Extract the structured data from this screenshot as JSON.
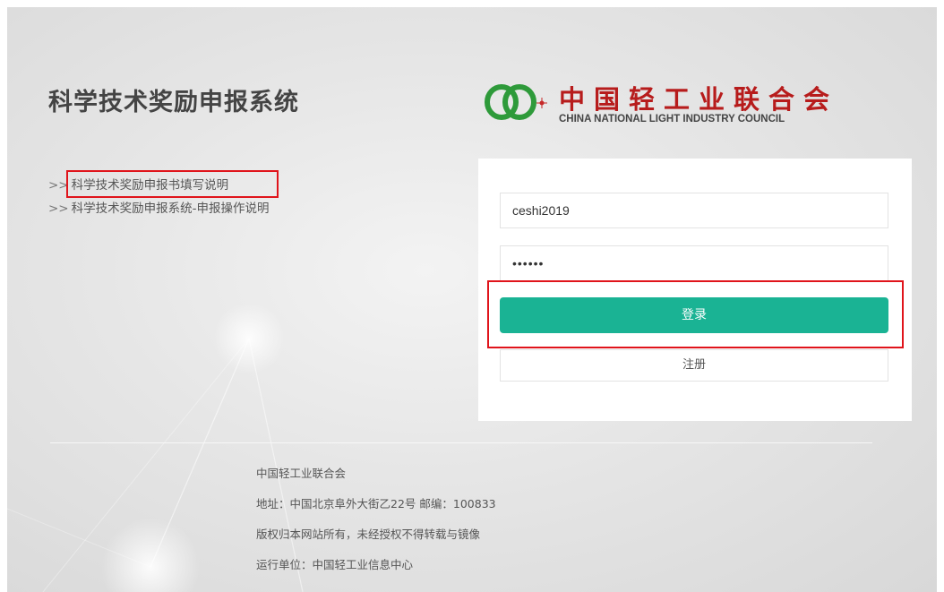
{
  "system_title": "科学技术奖励申报系统",
  "links": [
    {
      "prefix": ">>",
      "label": "科学技术奖励申报书填写说明"
    },
    {
      "prefix": ">>",
      "label": "科学技术奖励申报系统-申报操作说明"
    }
  ],
  "logo": {
    "name_cn": "中国轻工业联合会",
    "name_en": "CHINA NATIONAL LIGHT INDUSTRY COUNCIL",
    "icon": "cnlic-logo-icon"
  },
  "login": {
    "username_value": "ceshi2019",
    "password_value": "••••••",
    "login_label": "登录",
    "register_label": "注册"
  },
  "footer": {
    "org": "中国轻工业联合会",
    "address": "地址：中国北京阜外大街乙22号 邮编：100833",
    "copyright": "版权归本网站所有，未经授权不得转载与镜像",
    "operator": "运行单位：中国轻工业信息中心"
  },
  "colors": {
    "primary_button": "#1ab394",
    "annotation_box": "#e0141b",
    "logo_red": "#b71c1c",
    "logo_green": "#2e9a3a"
  }
}
